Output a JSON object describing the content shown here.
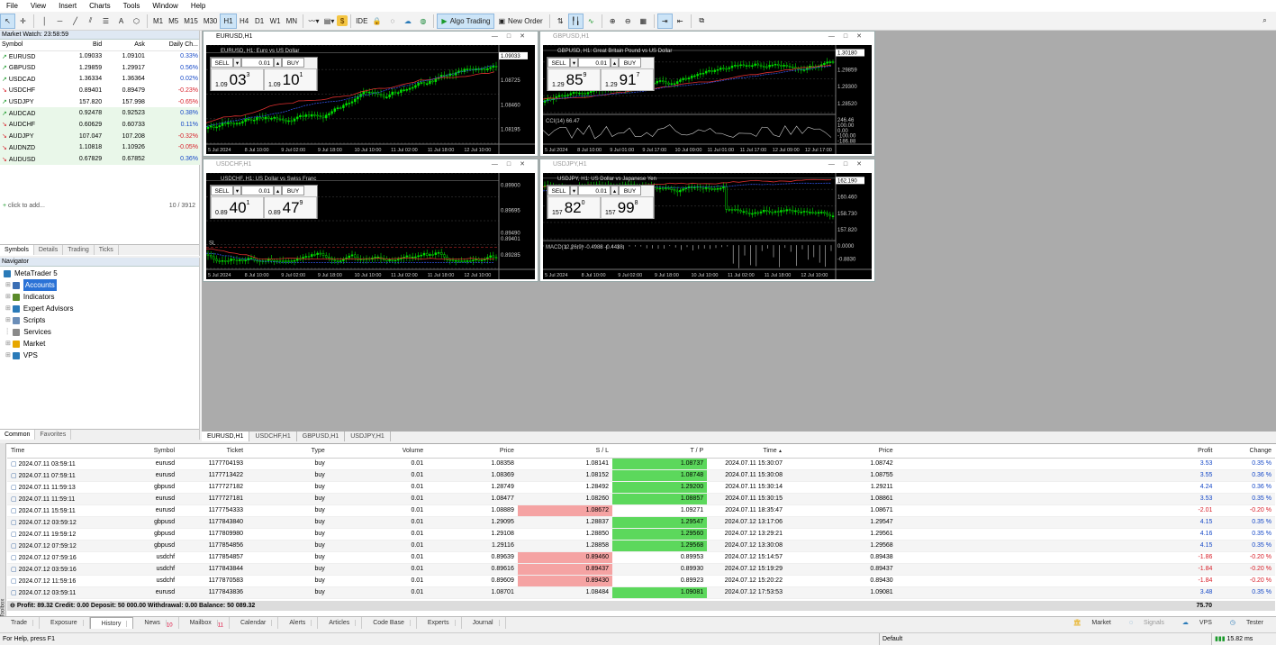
{
  "menu": [
    "File",
    "View",
    "Insert",
    "Charts",
    "Tools",
    "Window",
    "Help"
  ],
  "toolbar": {
    "timeframes": [
      "M1",
      "M5",
      "M15",
      "M30",
      "H1",
      "H4",
      "D1",
      "W1",
      "MN"
    ],
    "active_tf": "H1",
    "ide": "IDE",
    "algo": "Algo Trading",
    "new_order": "New Order"
  },
  "market_watch": {
    "title": "Market Watch: 23:58:59",
    "headers": [
      "Symbol",
      "Bid",
      "Ask",
      "Daily Ch..."
    ],
    "rows": [
      {
        "s": "EURUSD",
        "bid": "1.09033",
        "ask": "1.09101",
        "ch": "0.33%",
        "dir": "up"
      },
      {
        "s": "GBPUSD",
        "bid": "1.29859",
        "ask": "1.29917",
        "ch": "0.56%",
        "dir": "up"
      },
      {
        "s": "USDCAD",
        "bid": "1.36334",
        "ask": "1.36364",
        "ch": "0.02%",
        "dir": "up"
      },
      {
        "s": "USDCHF",
        "bid": "0.89401",
        "ask": "0.89479",
        "ch": "-0.23%",
        "dir": "down"
      },
      {
        "s": "USDJPY",
        "bid": "157.820",
        "ask": "157.998",
        "ch": "-0.65%",
        "dir": "up"
      },
      {
        "s": "AUDCAD",
        "bid": "0.92478",
        "ask": "0.92523",
        "ch": "0.38%",
        "dir": "up"
      },
      {
        "s": "AUDCHF",
        "bid": "0.60629",
        "ask": "0.60733",
        "ch": "0.11%",
        "dir": "down"
      },
      {
        "s": "AUDJPY",
        "bid": "107.047",
        "ask": "107.208",
        "ch": "-0.32%",
        "dir": "down"
      },
      {
        "s": "AUDNZD",
        "bid": "1.10818",
        "ask": "1.10926",
        "ch": "-0.05%",
        "dir": "down"
      },
      {
        "s": "AUDUSD",
        "bid": "0.67829",
        "ask": "0.67852",
        "ch": "0.36%",
        "dir": "down"
      }
    ],
    "add": "click to add...",
    "count": "10 / 3912",
    "tabs": [
      "Symbols",
      "Details",
      "Trading",
      "Ticks"
    ]
  },
  "navigator": {
    "title": "Navigator",
    "items": [
      "MetaTrader 5",
      "Accounts",
      "Indicators",
      "Expert Advisors",
      "Scripts",
      "Services",
      "Market",
      "VPS"
    ],
    "tabs": [
      "Common",
      "Favorites"
    ]
  },
  "charts": [
    {
      "title": "EURUSD,H1",
      "desc": "EURUSD, H1:  Euro vs US Dollar",
      "sell": "SELL",
      "buy": "BUY",
      "lot": "0.01",
      "sp": "1.09",
      "sb": "03",
      "ss": "3",
      "bp": "1.09",
      "bb": "10",
      "bs": "1",
      "prices": [
        "1.09033",
        "1.08725",
        "1.08460",
        "1.08195"
      ],
      "dates": [
        "5 Jul 2024",
        "8 Jul 10:00",
        "9 Jul 02:00",
        "9 Jul 18:00",
        "10 Jul 10:00",
        "11 Jul 02:00",
        "11 Jul 18:00",
        "12 Jul 10:00"
      ]
    },
    {
      "title": "GBPUSD,H1",
      "desc": "GBPUSD, H1:  Great Britain Pound vs US Dollar",
      "sell": "SELL",
      "buy": "BUY",
      "lot": "0.01",
      "sp": "1.29",
      "sb": "85",
      "ss": "9",
      "bp": "1.29",
      "bb": "91",
      "bs": "7",
      "prices": [
        "1.30180",
        "1.29859",
        "1.29300",
        "1.28520"
      ],
      "ind": "CCI(14) 66.47",
      "ind_vals": [
        "246.46",
        "100.00",
        "0.00",
        "-100.00",
        "-186.88"
      ],
      "dates": [
        "5 Jul 2024",
        "8 Jul 10:00",
        "9 Jul 01:00",
        "9 Jul 17:00",
        "10 Jul 09:00",
        "11 Jul 01:00",
        "11 Jul 17:00",
        "12 Jul 09:00",
        "12 Jul 17:00"
      ]
    },
    {
      "title": "USDCHF,H1",
      "desc": "USDCHF, H1:  US Dollar vs Swiss Franc",
      "sell": "SELL",
      "buy": "BUY",
      "lot": "0.01",
      "sp": "0.89",
      "sb": "40",
      "ss": "1",
      "bp": "0.89",
      "bb": "47",
      "bs": "9",
      "prices": [
        "0.89900",
        "0.89695",
        "0.89490",
        "0.89401",
        "0.89285"
      ],
      "sl": "SL",
      "dates": [
        "5 Jul 2024",
        "8 Jul 10:00",
        "9 Jul 02:00",
        "9 Jul 18:00",
        "10 Jul 10:00",
        "11 Jul 02:00",
        "11 Jul 18:00",
        "12 Jul 10:00"
      ]
    },
    {
      "title": "USDJPY,H1",
      "desc": "USDJPY, H1:  US Dollar vs Japanese Yen",
      "sell": "SELL",
      "buy": "BUY",
      "lot": "0.01",
      "sp": "157",
      "sb": "82",
      "ss": "0",
      "bp": "157",
      "bb": "99",
      "bs": "8",
      "prices": [
        "162.190",
        "160.460",
        "158.730",
        "157.820"
      ],
      "ind": "MACD(12,26,9) -0.4988 -0.4438",
      "ind_vals": [
        "0.0000",
        "-0.8830"
      ],
      "dates": [
        "5 Jul 2024",
        "8 Jul 10:00",
        "9 Jul 02:00",
        "9 Jul 18:00",
        "10 Jul 10:00",
        "11 Jul 02:00",
        "11 Jul 18:00",
        "12 Jul 10:00"
      ]
    }
  ],
  "chart_tabs": [
    "EURUSD,H1",
    "USDCHF,H1",
    "GBPUSD,H1",
    "USDJPY,H1"
  ],
  "history": {
    "headers": [
      "Time",
      "Symbol",
      "Ticket",
      "Type",
      "Volume",
      "Price",
      "S / L",
      "T / P",
      "Time",
      "Price",
      "Profit",
      "Change"
    ],
    "rows": [
      [
        "2024.07.11 03:59:11",
        "eurusd",
        "1177704193",
        "buy",
        "0.01",
        "1.08358",
        "1.08141",
        "1.08737",
        "2024.07.11 15:30:07",
        "1.08742",
        "3.53",
        "0.35 %",
        "",
        "g"
      ],
      [
        "2024.07.11 07:59:11",
        "eurusd",
        "1177713422",
        "buy",
        "0.01",
        "1.08369",
        "1.08152",
        "1.08748",
        "2024.07.11 15:30:08",
        "1.08755",
        "3.55",
        "0.36 %",
        "",
        "g"
      ],
      [
        "2024.07.11 11:59:13",
        "gbpusd",
        "1177727182",
        "buy",
        "0.01",
        "1.28749",
        "1.28492",
        "1.29200",
        "2024.07.11 15:30:14",
        "1.29211",
        "4.24",
        "0.36 %",
        "",
        "g"
      ],
      [
        "2024.07.11 11:59:11",
        "eurusd",
        "1177727181",
        "buy",
        "0.01",
        "1.08477",
        "1.08260",
        "1.08857",
        "2024.07.11 15:30:15",
        "1.08861",
        "3.53",
        "0.35 %",
        "",
        "g"
      ],
      [
        "2024.07.11 15:59:11",
        "eurusd",
        "1177754333",
        "buy",
        "0.01",
        "1.08889",
        "1.08672",
        "1.09271",
        "2024.07.11 18:35:47",
        "1.08671",
        "-2.01",
        "-0.20 %",
        "r",
        ""
      ],
      [
        "2024.07.12 03:59:12",
        "gbpusd",
        "1177843840",
        "buy",
        "0.01",
        "1.29095",
        "1.28837",
        "1.29547",
        "2024.07.12 13:17:06",
        "1.29547",
        "4.15",
        "0.35 %",
        "",
        "g"
      ],
      [
        "2024.07.11 19:59:12",
        "gbpusd",
        "1177809980",
        "buy",
        "0.01",
        "1.29108",
        "1.28850",
        "1.29560",
        "2024.07.12 13:29:21",
        "1.29561",
        "4.16",
        "0.35 %",
        "",
        "g"
      ],
      [
        "2024.07.12 07:59:12",
        "gbpusd",
        "1177854856",
        "buy",
        "0.01",
        "1.29116",
        "1.28858",
        "1.29568",
        "2024.07.12 13:30:08",
        "1.29568",
        "4.15",
        "0.35 %",
        "",
        "g"
      ],
      [
        "2024.07.12 07:59:16",
        "usdchf",
        "1177854857",
        "buy",
        "0.01",
        "0.89639",
        "0.89460",
        "0.89953",
        "2024.07.12 15:14:57",
        "0.89438",
        "-1.86",
        "-0.20 %",
        "r",
        ""
      ],
      [
        "2024.07.12 03:59:16",
        "usdchf",
        "1177843844",
        "buy",
        "0.01",
        "0.89616",
        "0.89437",
        "0.89930",
        "2024.07.12 15:19:29",
        "0.89437",
        "-1.84",
        "-0.20 %",
        "r",
        ""
      ],
      [
        "2024.07.12 11:59:16",
        "usdchf",
        "1177870583",
        "buy",
        "0.01",
        "0.89609",
        "0.89430",
        "0.89923",
        "2024.07.12 15:20:22",
        "0.89430",
        "-1.84",
        "-0.20 %",
        "r",
        ""
      ],
      [
        "2024.07.12 03:59:11",
        "eurusd",
        "1177843836",
        "buy",
        "0.01",
        "1.08701",
        "1.08484",
        "1.09081",
        "2024.07.12 17:53:53",
        "1.09081",
        "3.48",
        "0.35 %",
        "",
        "g"
      ]
    ],
    "summary": "Profit: 89.32  Credit: 0.00  Deposit: 50 000.00  Withdrawal: 0.00  Balance: 50 089.32",
    "total": "75.70"
  },
  "bottom_tabs": [
    {
      "label": "Trade",
      "badge": ""
    },
    {
      "label": "Exposure",
      "badge": ""
    },
    {
      "label": "History",
      "badge": ""
    },
    {
      "label": "News",
      "badge": "10"
    },
    {
      "label": "Mailbox",
      "badge": "11"
    },
    {
      "label": "Calendar",
      "badge": ""
    },
    {
      "label": "Alerts",
      "badge": ""
    },
    {
      "label": "Articles",
      "badge": ""
    },
    {
      "label": "Code Base",
      "badge": ""
    },
    {
      "label": "Experts",
      "badge": ""
    },
    {
      "label": "Journal",
      "badge": ""
    }
  ],
  "bottom_right": [
    "Market",
    "Signals",
    "VPS",
    "Tester"
  ],
  "toolbox_label": "Toolbox",
  "status": {
    "help": "For Help, press F1",
    "profile": "Default",
    "ping": "15.82 ms"
  }
}
